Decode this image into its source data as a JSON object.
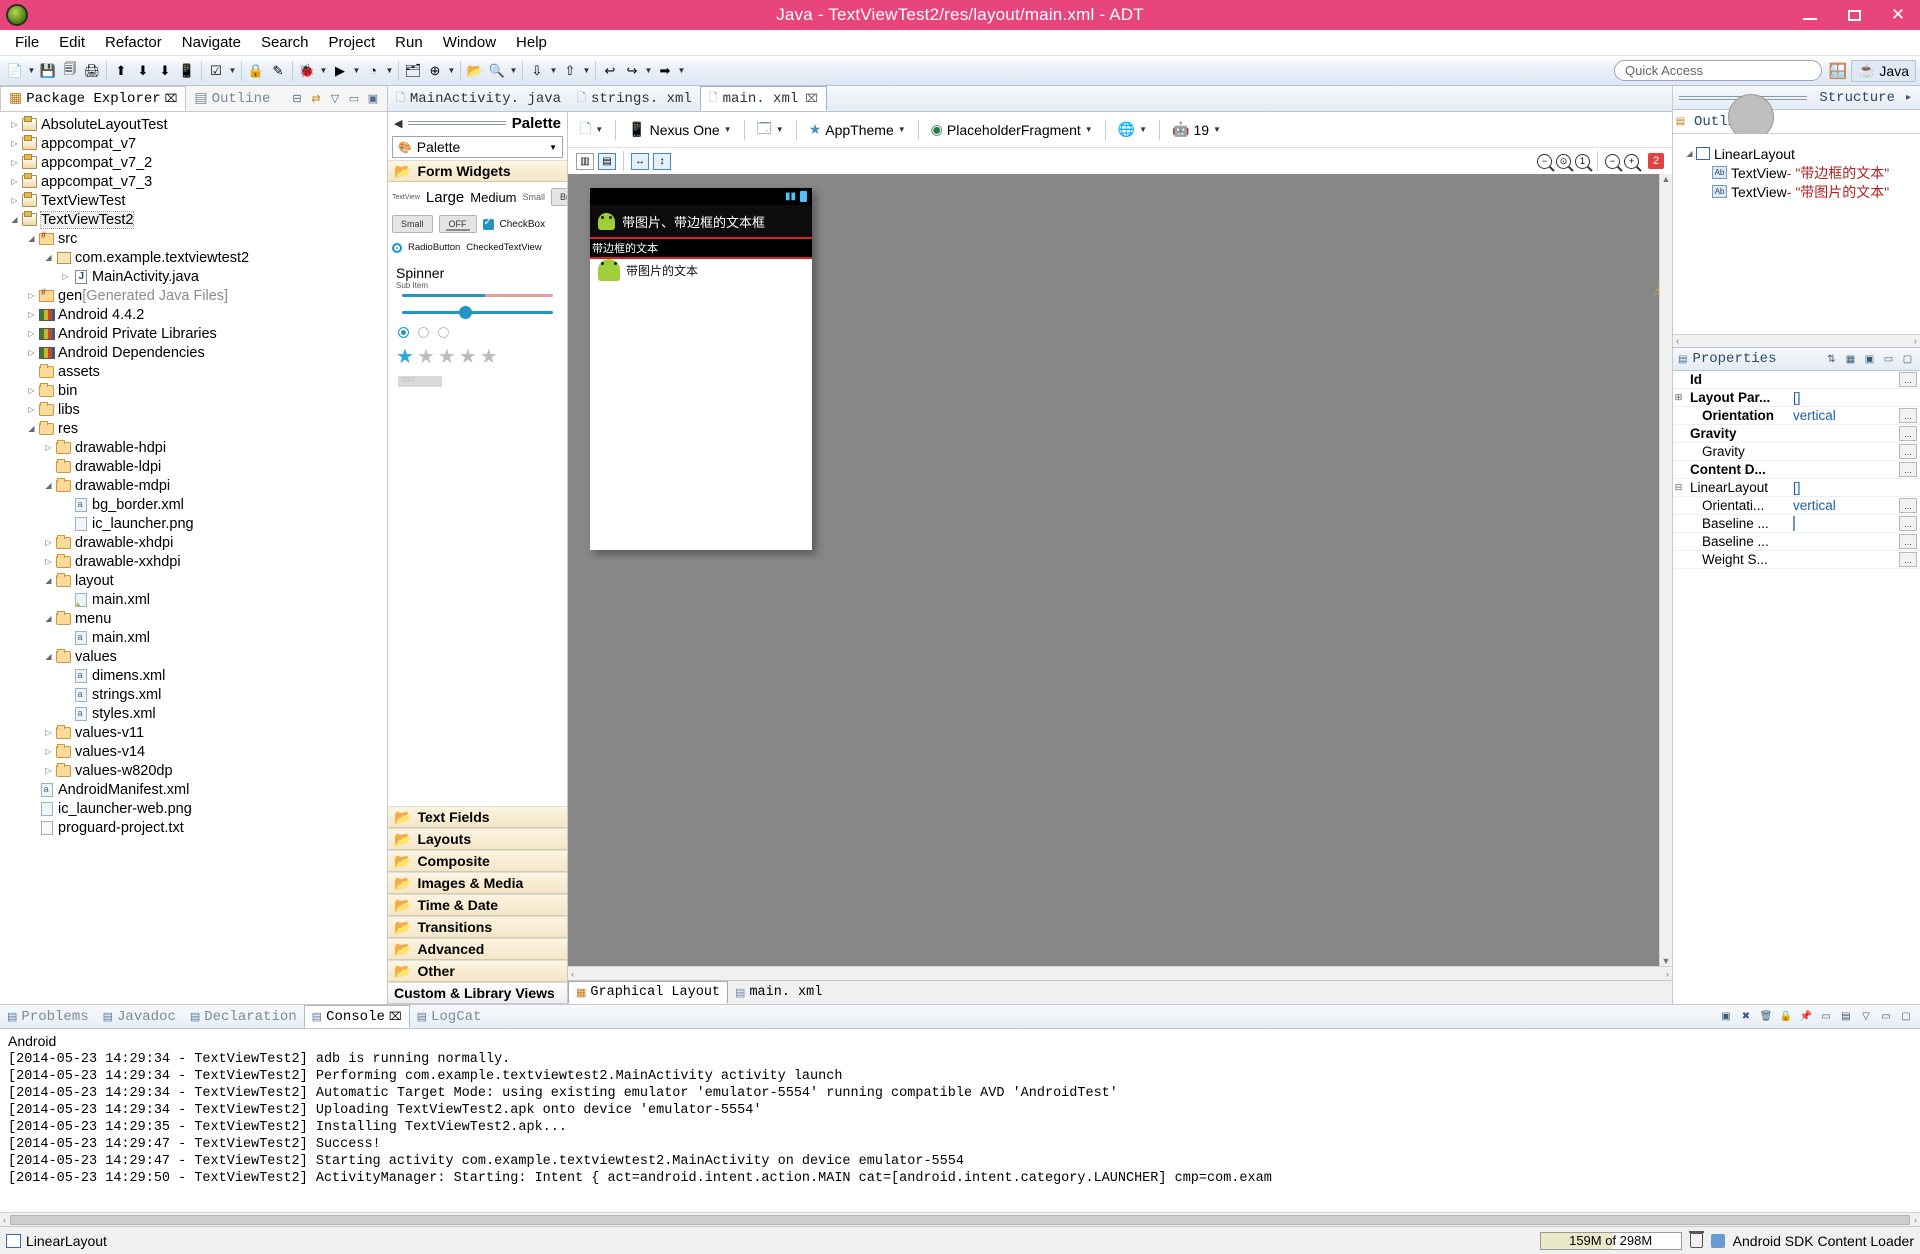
{
  "window": {
    "title": "Java - TextViewTest2/res/layout/main.xml - ADT",
    "app_icon": "eclipse-icon",
    "minimize": "–",
    "maximize": "❐",
    "close": "✕"
  },
  "menubar": {
    "items": [
      "File",
      "Edit",
      "Refactor",
      "Navigate",
      "Search",
      "Project",
      "Run",
      "Window",
      "Help"
    ]
  },
  "toolbar": {
    "quick_access_placeholder": "Quick Access",
    "perspective_label": "Java"
  },
  "package_explorer": {
    "tab_label": "Package Explorer",
    "tab_close": "⌧",
    "outline_tab_label": "Outline",
    "tree": [
      {
        "label": "AbsoluteLayoutTest",
        "indent": 0,
        "twisty": "▷",
        "icon": "project-icon"
      },
      {
        "label": "appcompat_v7",
        "indent": 0,
        "twisty": "▷",
        "icon": "project-icon"
      },
      {
        "label": "appcompat_v7_2",
        "indent": 0,
        "twisty": "▷",
        "icon": "project-icon"
      },
      {
        "label": "appcompat_v7_3",
        "indent": 0,
        "twisty": "▷",
        "icon": "project-icon"
      },
      {
        "label": "TextViewTest",
        "indent": 0,
        "twisty": "▷",
        "icon": "project-icon"
      },
      {
        "label": "TextViewTest2",
        "indent": 0,
        "twisty": "◢",
        "icon": "project-icon",
        "selected": true
      },
      {
        "label": "src",
        "indent": 1,
        "twisty": "◢",
        "icon": "source-folder-icon"
      },
      {
        "label": "com.example.textviewtest2",
        "indent": 2,
        "twisty": "◢",
        "icon": "package-icon"
      },
      {
        "label": "MainActivity.java",
        "indent": 3,
        "twisty": "▷",
        "icon": "java-file-icon"
      },
      {
        "label": "gen",
        "suffix": "[Generated Java Files]",
        "indent": 1,
        "twisty": "▷",
        "icon": "source-folder-icon"
      },
      {
        "label": "Android 4.4.2",
        "indent": 1,
        "twisty": "▷",
        "icon": "library-icon"
      },
      {
        "label": "Android Private Libraries",
        "indent": 1,
        "twisty": "▷",
        "icon": "library-icon"
      },
      {
        "label": "Android Dependencies",
        "indent": 1,
        "twisty": "▷",
        "icon": "library-icon"
      },
      {
        "label": "assets",
        "indent": 1,
        "twisty": "",
        "icon": "folder-icon"
      },
      {
        "label": "bin",
        "indent": 1,
        "twisty": "▷",
        "icon": "folder-icon"
      },
      {
        "label": "libs",
        "indent": 1,
        "twisty": "▷",
        "icon": "folder-icon"
      },
      {
        "label": "res",
        "indent": 1,
        "twisty": "◢",
        "icon": "folder-icon"
      },
      {
        "label": "drawable-hdpi",
        "indent": 2,
        "twisty": "▷",
        "icon": "folder-icon"
      },
      {
        "label": "drawable-ldpi",
        "indent": 2,
        "twisty": "",
        "icon": "folder-icon"
      },
      {
        "label": "drawable-mdpi",
        "indent": 2,
        "twisty": "◢",
        "icon": "folder-icon"
      },
      {
        "label": "bg_border.xml",
        "indent": 3,
        "twisty": "",
        "icon": "xml-file-icon"
      },
      {
        "label": "ic_launcher.png",
        "indent": 3,
        "twisty": "",
        "icon": "png-file-icon"
      },
      {
        "label": "drawable-xhdpi",
        "indent": 2,
        "twisty": "▷",
        "icon": "folder-icon"
      },
      {
        "label": "drawable-xxhdpi",
        "indent": 2,
        "twisty": "▷",
        "icon": "folder-icon"
      },
      {
        "label": "layout",
        "indent": 2,
        "twisty": "◢",
        "icon": "folder-icon"
      },
      {
        "label": "main.xml",
        "indent": 3,
        "twisty": "",
        "icon": "xml-warning-file-icon"
      },
      {
        "label": "menu",
        "indent": 2,
        "twisty": "◢",
        "icon": "folder-icon"
      },
      {
        "label": "main.xml",
        "indent": 3,
        "twisty": "",
        "icon": "xml-file-icon"
      },
      {
        "label": "values",
        "indent": 2,
        "twisty": "◢",
        "icon": "folder-icon"
      },
      {
        "label": "dimens.xml",
        "indent": 3,
        "twisty": "",
        "icon": "xml-file-icon"
      },
      {
        "label": "strings.xml",
        "indent": 3,
        "twisty": "",
        "icon": "xml-file-icon"
      },
      {
        "label": "styles.xml",
        "indent": 3,
        "twisty": "",
        "icon": "xml-file-icon"
      },
      {
        "label": "values-v11",
        "indent": 2,
        "twisty": "▷",
        "icon": "folder-icon"
      },
      {
        "label": "values-v14",
        "indent": 2,
        "twisty": "▷",
        "icon": "folder-icon"
      },
      {
        "label": "values-w820dp",
        "indent": 2,
        "twisty": "▷",
        "icon": "folder-icon"
      },
      {
        "label": "AndroidManifest.xml",
        "indent": 1,
        "twisty": "",
        "icon": "xml-file-icon"
      },
      {
        "label": "ic_launcher-web.png",
        "indent": 1,
        "twisty": "",
        "icon": "png-file-icon"
      },
      {
        "label": "proguard-project.txt",
        "indent": 1,
        "twisty": "",
        "icon": "text-file-icon"
      }
    ]
  },
  "editor": {
    "tabs": [
      {
        "label": "MainActivity. java",
        "icon": "java-file-icon",
        "active": false,
        "closable": false
      },
      {
        "label": "strings. xml",
        "icon": "xml-file-icon",
        "active": false,
        "closable": false
      },
      {
        "label": "main. xml",
        "icon": "xml-file-icon",
        "active": true,
        "closable": true,
        "close": "⌧"
      }
    ]
  },
  "palette": {
    "header_title": "Palette",
    "back_arrow": "◀",
    "combo_label": "Palette",
    "groups_top": [
      "Form Widgets"
    ],
    "groups": [
      "Text Fields",
      "Layouts",
      "Composite",
      "Images & Media",
      "Time & Date",
      "Transitions",
      "Advanced",
      "Other"
    ],
    "custom_views": "Custom & Library Views",
    "widgets": {
      "textview_small": "TextView",
      "large": "Large",
      "medium": "Medium",
      "small": "Small",
      "button": "Button",
      "small_button": "Small",
      "off_toggle": "OFF",
      "checkbox": "CheckBox",
      "radiobutton": "RadioButton",
      "checkedtextview": "CheckedTextView",
      "spinner": "Spinner",
      "sub_item": "Sub Item",
      "switch_off": "OFF"
    }
  },
  "graphical_layout": {
    "config": {
      "device": "Nexus One",
      "theme": "AppTheme",
      "fragment": "PlaceholderFragment",
      "api_level": "19",
      "dropdown": "▼"
    },
    "error_badge": "2",
    "zoom_icons": [
      "zoom-fit-icon",
      "zoom-normal-icon",
      "zoom-100-icon",
      "zoom-out-icon",
      "zoom-in-icon"
    ],
    "preview": {
      "action_bar_title": "带图片、带边框的文本框",
      "bordered_text": "带边框的文本",
      "image_text": "带图片的文本"
    },
    "tabs": [
      {
        "label": "Graphical Layout",
        "active": true,
        "icon": "layout-icon"
      },
      {
        "label": "main. xml",
        "active": false,
        "icon": "xml-icon"
      }
    ]
  },
  "structure": {
    "title": "Outline",
    "panel_label": "Structure",
    "tree": [
      {
        "label": "LinearLayout",
        "indent": 0,
        "twisty": "◢",
        "icon": "linearlayout-icon"
      },
      {
        "label": "TextView",
        "value": " - \"带边框的文本\"",
        "indent": 1,
        "twisty": "",
        "icon": "textview-icon"
      },
      {
        "label": "TextView",
        "value": " - \"带图片的文本\"",
        "indent": 1,
        "twisty": "",
        "icon": "textview-icon"
      }
    ]
  },
  "properties": {
    "title": "Properties",
    "rows": [
      {
        "name": "Id",
        "value": "",
        "bold": true,
        "indent": 0,
        "button": "..."
      },
      {
        "name": "Layout Par...",
        "value": "[]",
        "bold": true,
        "indent": 0,
        "expander": "⊞",
        "button": ""
      },
      {
        "name": "Orientation",
        "value": "vertical",
        "bold": true,
        "indent": 1,
        "button": "..."
      },
      {
        "name": "Gravity",
        "value": "",
        "bold": true,
        "indent": 0,
        "button": "..."
      },
      {
        "name": "Gravity",
        "value": "",
        "bold": false,
        "indent": 1,
        "button": "..."
      },
      {
        "name": "Content D...",
        "value": "",
        "bold": true,
        "indent": 0,
        "button": "..."
      },
      {
        "name": "LinearLayout",
        "value": "[]",
        "bold": false,
        "indent": 0,
        "expander": "⊟",
        "button": ""
      },
      {
        "name": "Orientati...",
        "value": "vertical",
        "bold": false,
        "indent": 1,
        "button": "..."
      },
      {
        "name": "Baseline ...",
        "value": "",
        "bold": false,
        "indent": 1,
        "swatch": true,
        "button": "..."
      },
      {
        "name": "Baseline ...",
        "value": "",
        "bold": false,
        "indent": 1,
        "button": "..."
      },
      {
        "name": "Weight S...",
        "value": "",
        "bold": false,
        "indent": 1,
        "button": "..."
      }
    ]
  },
  "console": {
    "tabs": [
      {
        "label": "Problems",
        "active": false,
        "icon": "problems-icon"
      },
      {
        "label": "Javadoc",
        "active": false,
        "icon": "javadoc-icon"
      },
      {
        "label": "Declaration",
        "active": false,
        "icon": "declaration-icon"
      },
      {
        "label": "Console",
        "active": true,
        "icon": "console-icon",
        "close": "⌧"
      },
      {
        "label": "LogCat",
        "active": false,
        "icon": "logcat-icon"
      }
    ],
    "header": "Android",
    "lines": [
      "[2014-05-23 14:29:34 - TextViewTest2] adb is running normally.",
      "[2014-05-23 14:29:34 - TextViewTest2] Performing com.example.textviewtest2.MainActivity activity launch",
      "[2014-05-23 14:29:34 - TextViewTest2] Automatic Target Mode: using existing emulator 'emulator-5554' running compatible AVD 'AndroidTest'",
      "[2014-05-23 14:29:34 - TextViewTest2] Uploading TextViewTest2.apk onto device 'emulator-5554'",
      "[2014-05-23 14:29:35 - TextViewTest2] Installing TextViewTest2.apk...",
      "[2014-05-23 14:29:47 - TextViewTest2] Success!",
      "[2014-05-23 14:29:47 - TextViewTest2] Starting activity com.example.textviewtest2.MainActivity on device emulator-5554",
      "[2014-05-23 14:29:50 - TextViewTest2] ActivityManager: Starting: Intent { act=android.intent.action.MAIN cat=[android.intent.category.LAUNCHER] cmp=com.exam"
    ]
  },
  "statusbar": {
    "selection": "LinearLayout",
    "memory": "159M of 298M",
    "job": "Android SDK Content Loader"
  }
}
